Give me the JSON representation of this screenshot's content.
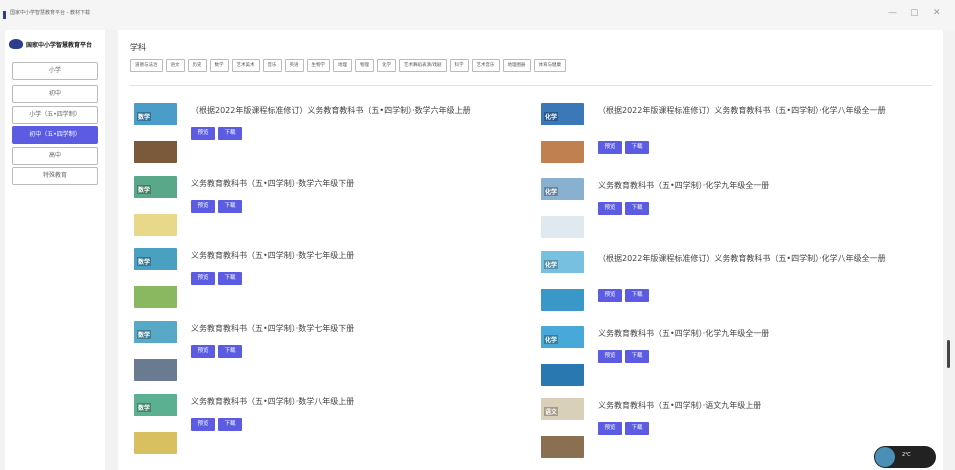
{
  "window": {
    "title": "国家中小学智慧教育平台 - 教材下载",
    "controls": [
      "—",
      "▢",
      "✕"
    ]
  },
  "sidebar": {
    "logo_text": "国家中小学智慧教育平台",
    "items": [
      {
        "label": "小学",
        "active": false
      },
      {
        "label": "初中",
        "active": false
      },
      {
        "label": "小学（五•四学制）",
        "active": false
      },
      {
        "label": "初中（五•四学制）",
        "active": true
      },
      {
        "label": "高中",
        "active": false
      },
      {
        "label": "特殊教育",
        "active": false
      }
    ]
  },
  "main": {
    "subject_heading": "学科",
    "subjects": [
      "道德与法治",
      "语文",
      "历史",
      "数学",
      "艺术美术",
      "音乐",
      "英语",
      "生物学",
      "地理",
      "物理",
      "化学",
      "艺术舞蹈表演/戏剧",
      "科学",
      "艺术音乐",
      "地理图册",
      "体育与健康"
    ],
    "preview_label": "预览",
    "download_label": "下载",
    "books_left": [
      {
        "title": "（根据2022年版课程标准修订）义务教育教科书（五•四学制）·数学六年级上册",
        "cover_label": "数学",
        "cover_top": "#4a9cc9",
        "cover_bottom": "#7a5a3a"
      },
      {
        "title": "义务教育教科书（五•四学制）·数学六年级下册",
        "cover_label": "数学",
        "cover_top": "#5aa88a",
        "cover_bottom": "#e8d98a"
      },
      {
        "title": "义务教育教科书（五•四学制）·数学七年级上册",
        "cover_label": "数学",
        "cover_top": "#4aa0c0",
        "cover_bottom": "#8ab860"
      },
      {
        "title": "义务教育教科书（五•四学制）·数学七年级下册",
        "cover_label": "数学",
        "cover_top": "#58a8c8",
        "cover_bottom": "#6a7a90"
      },
      {
        "title": "义务教育教科书（五•四学制）·数学八年级上册",
        "cover_label": "数学",
        "cover_top": "#5ab090",
        "cover_bottom": "#d8c060"
      }
    ],
    "books_right": [
      {
        "title": "（根据2022年版课程标准修订）义务教育教科书（五•四学制）·化学八年级全一册",
        "cover_label": "化学",
        "cover_top": "#3a78b8",
        "cover_bottom": "#c08050"
      },
      {
        "title": "义务教育教科书（五•四学制）·化学九年级全一册",
        "cover_label": "化学",
        "cover_top": "#8ab0d0",
        "cover_bottom": "#e0e8f0"
      },
      {
        "title": "（根据2022年版课程标准修订）义务教育教科书（五•四学制）·化学八年级全一册",
        "cover_label": "化学",
        "cover_top": "#78c0e0",
        "cover_bottom": "#3a98c8"
      },
      {
        "title": "义务教育教科书（五•四学制）·化学九年级全一册",
        "cover_label": "化学",
        "cover_top": "#48a8d8",
        "cover_bottom": "#2a78b0"
      },
      {
        "title": "义务教育教科书（五•四学制）·语文九年级上册",
        "cover_label": "语文",
        "cover_top": "#d8d0b8",
        "cover_bottom": "#8a7050"
      }
    ]
  },
  "widget": {
    "text": "2℃"
  }
}
